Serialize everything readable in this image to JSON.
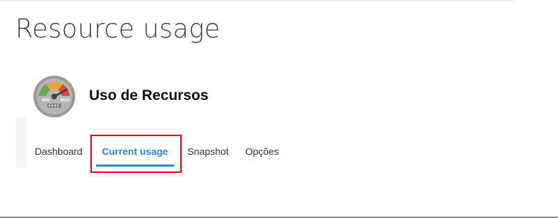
{
  "page": {
    "title": "Resource usage"
  },
  "app": {
    "name": "Uso de Recursos",
    "icon": "gauge-icon",
    "icon_min_label": "MIN",
    "icon_max_label": "MAX"
  },
  "tabs": [
    {
      "label": "Dashboard",
      "active": false
    },
    {
      "label": "Current usage",
      "active": true
    },
    {
      "label": "Snapshot",
      "active": false
    },
    {
      "label": "Opções",
      "active": false
    }
  ],
  "colors": {
    "accent": "#2a87d0",
    "highlight": "#e0060f"
  }
}
